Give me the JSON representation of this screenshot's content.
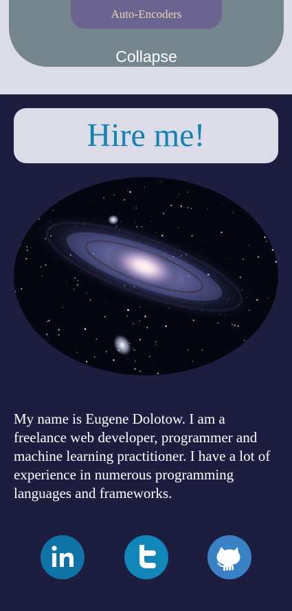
{
  "nav": {
    "menu_item_label": "Auto-Encoders",
    "collapse_label": "Collapse"
  },
  "hero": {
    "hire_label": "Hire me!"
  },
  "bio": {
    "text": "My name is Eugene Dolotow. I am a freelance web developer, programmer and machine learning practitioner. I have a lot of experience in numerous programming languages and frameworks."
  },
  "social": [
    {
      "icon": "linkedin-icon",
      "color": "#0f73a8"
    },
    {
      "icon": "twitter-icon",
      "color": "#1186b8"
    },
    {
      "icon": "github-icon",
      "color": "#3781c4"
    }
  ],
  "colors": {
    "page_background": "#1d1d3f",
    "panel_light": "#dcdce8",
    "menu_panel": "#76868f",
    "menu_pill": "#6c6490",
    "accent_blue": "#1582b4"
  }
}
